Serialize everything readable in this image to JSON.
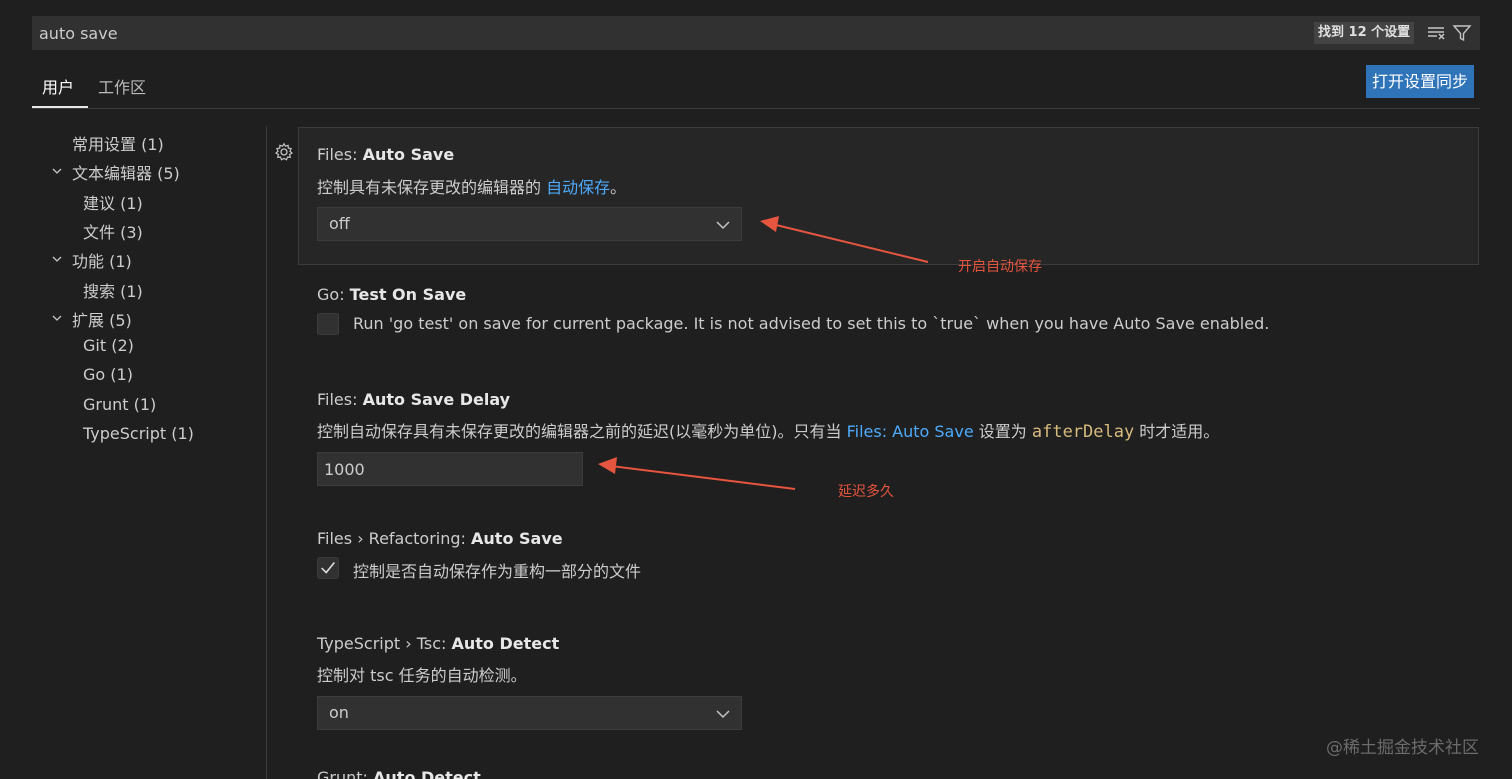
{
  "search": {
    "value": "auto save",
    "result_count": "找到 12 个设置",
    "clear_icon": "clear-filter-icon",
    "filter_icon": "filter-icon"
  },
  "tabs": [
    {
      "label": "用户",
      "active": true
    },
    {
      "label": "工作区",
      "active": false
    }
  ],
  "sync_button": "打开设置同步",
  "toc": [
    {
      "label": "常用设置 (1)",
      "level": 0,
      "expandable": false
    },
    {
      "label": "文本编辑器 (5)",
      "level": 0,
      "expandable": true
    },
    {
      "label": "建议 (1)",
      "level": 1
    },
    {
      "label": "文件 (3)",
      "level": 1
    },
    {
      "label": "功能 (1)",
      "level": 0,
      "expandable": true
    },
    {
      "label": "搜索 (1)",
      "level": 1
    },
    {
      "label": "扩展 (5)",
      "level": 0,
      "expandable": true
    },
    {
      "label": "Git (2)",
      "level": 1
    },
    {
      "label": "Go (1)",
      "level": 1
    },
    {
      "label": "Grunt (1)",
      "level": 1
    },
    {
      "label": "TypeScript (1)",
      "level": 1
    }
  ],
  "settings": {
    "files_auto_save": {
      "category": "Files: ",
      "name": "Auto Save",
      "desc_prefix": "控制具有未保存更改的编辑器的 ",
      "desc_link": "自动保存",
      "desc_suffix": "。",
      "value": "off"
    },
    "go_test_on_save": {
      "category": "Go: ",
      "name": "Test On Save",
      "desc": "Run 'go test' on save for current package. It is not advised to set this to `true` when you have Auto Save enabled.",
      "checked": false
    },
    "files_auto_save_delay": {
      "category": "Files: ",
      "name": "Auto Save Delay",
      "desc_prefix": "控制自动保存具有未保存更改的编辑器之前的延迟(以毫秒为单位)。只有当 ",
      "desc_link": "Files: Auto Save",
      "desc_mid": " 设置为 ",
      "desc_code": "afterDelay",
      "desc_suffix": " 时才适用。",
      "value": "1000"
    },
    "files_refactoring_auto_save": {
      "category": "Files › Refactoring: ",
      "name": "Auto Save",
      "desc": "控制是否自动保存作为重构一部分的文件",
      "checked": true
    },
    "typescript_tsc_auto_detect": {
      "category": "TypeScript › Tsc: ",
      "name": "Auto Detect",
      "desc": "控制对 tsc 任务的自动检测。",
      "value": "on"
    },
    "next_setting_partial": {
      "category": "Grunt: ",
      "name": "Auto Detect"
    }
  },
  "annotations": {
    "auto_save": "开启自动保存",
    "delay": "延迟多久"
  },
  "watermark": "@稀土掘金技术社区",
  "colors": {
    "background": "#1f1f1f",
    "link": "#4daafc",
    "accent_button": "#2f74b8",
    "annotation": "#e6553f"
  }
}
